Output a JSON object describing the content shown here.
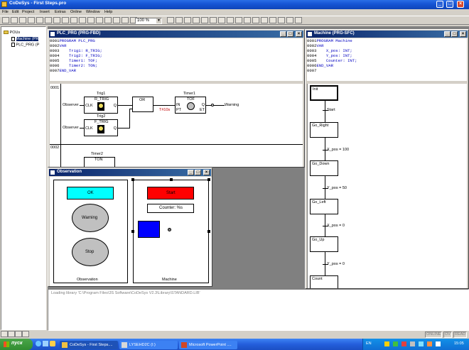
{
  "app": {
    "title": "CoDeSys - First Steps.pro"
  },
  "menu": [
    "File",
    "Edit",
    "Project",
    "Insert",
    "Extras",
    "Online",
    "Window",
    "Help"
  ],
  "toolbar": {
    "zoom": "100 %"
  },
  "tree": {
    "root": "POUs",
    "items": [
      "Machine (PR",
      "PLC_PRG (P"
    ]
  },
  "plc_window": {
    "title": "PLC_PRG (PRG-FBD)",
    "code": [
      {
        "n": "0001",
        "t": "PROGRAM PLC_PRG"
      },
      {
        "n": "0002",
        "t": "VAR"
      },
      {
        "n": "0003",
        "t": "    Trig1: R_TRIG;"
      },
      {
        "n": "0004",
        "t": "    Trig2: F_TRIG;"
      },
      {
        "n": "0005",
        "t": "    Timer1: TOF;"
      },
      {
        "n": "0006",
        "t": "    Timer2: TON;"
      },
      {
        "n": "0007",
        "t": "END_VAR"
      }
    ],
    "net1": "0001",
    "net2": "0002",
    "trig1_name": "Trig1",
    "trig1_type": "R_TRIG",
    "trig2_name": "Trig2",
    "trig2_type": "F_TRIG",
    "clk": "CLK",
    "q": "Q",
    "observer": "Observer",
    "or_label": "OR",
    "timer1_name": "Timer1",
    "timer1_type": "TOF",
    "in": "IN",
    "pt": "PT",
    "et": "ET",
    "time": "T#10s",
    "warning": "Warning",
    "timer2_name": "Timer2",
    "timer2_type": "TON"
  },
  "machine_window": {
    "title": "Machine (PRG-SFC)",
    "code": [
      {
        "n": "0001",
        "t": "PROGRAM Machine"
      },
      {
        "n": "0002",
        "t": "VAR"
      },
      {
        "n": "0003",
        "t": "    X_pos: INT;"
      },
      {
        "n": "0004",
        "t": "    Y_pos: INT;"
      },
      {
        "n": "0005",
        "t": "    Counter: INT;"
      },
      {
        "n": "0006",
        "t": "END_VAR"
      },
      {
        "n": "0007",
        "t": ""
      }
    ],
    "steps": [
      "Init",
      "Go_Right",
      "Go_Down",
      "Go_Left",
      "Go_Up",
      "Count"
    ],
    "transitions": [
      "Start",
      "X_pos = 100",
      "Y_pos = 50",
      "X_pos = 0",
      "Y_pos = 0"
    ]
  },
  "observation_window": {
    "title": "Observation",
    "ok": "OK",
    "warning": "Warning",
    "stop": "Stop",
    "obs_caption": "Observation",
    "start": "Start",
    "counter": "Counter: %s",
    "machine_caption": "Machine",
    "colors": {
      "ok": "#00ffff",
      "start": "#ff0000",
      "box": "#0000ff"
    }
  },
  "messages": {
    "line1": "Loading library 'C:\\Program Files\\3S Software\\CoDeSys V2.3\\Library\\STANDARD.LIB'"
  },
  "status": {
    "online": "ONLINE",
    "ov": "OV",
    "read": "READ"
  },
  "taskbar": {
    "start": "пуск",
    "tasks": [
      "CoDeSys - First Steps....",
      "LYSEHD2C (I:)",
      "Microsoft PowerPoint ...."
    ],
    "lang": "EN",
    "clock": "15:05"
  }
}
